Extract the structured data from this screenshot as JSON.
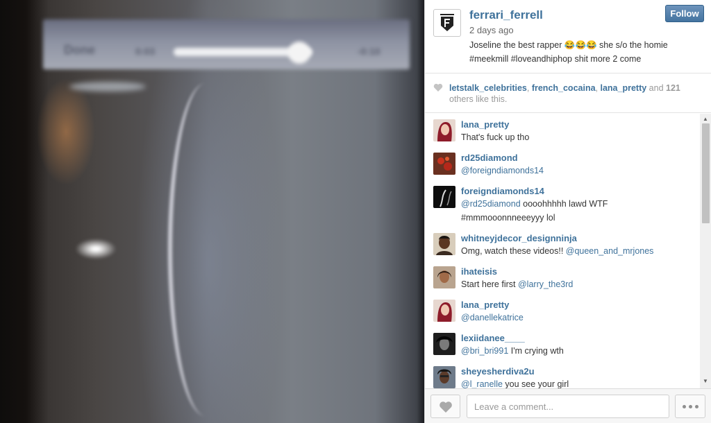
{
  "photo": {
    "bar_left": "Done",
    "bar_time_left": "0:03",
    "bar_time_right": "-0:10"
  },
  "post": {
    "username": "ferrari_ferrell",
    "time_ago": "2 days ago",
    "caption": "Joseline the best rapper 😂😂😂 she s/o the homie #meekmill #loveandhiphop shit more 2 come",
    "follow_label": "Follow"
  },
  "likes": {
    "users": [
      "letstalk_celebrities",
      "french_cocaina",
      "lana_pretty"
    ],
    "sep1": ", ",
    "sep2": ", ",
    "and": " and ",
    "count": "121",
    "suffix": " others like this."
  },
  "comments": [
    {
      "user": "lana_pretty",
      "parts": [
        {
          "t": "That's fuck up tho",
          "m": false
        }
      ],
      "avatar": "lana"
    },
    {
      "user": "rd25diamond",
      "parts": [
        {
          "t": "@foreigndiamonds14",
          "m": true
        }
      ],
      "avatar": "rd25"
    },
    {
      "user": "foreigndiamonds14",
      "parts": [
        {
          "t": "@rd25diamond",
          "m": true
        },
        {
          "t": " oooohhhhh lawd WTF #mmmooonnneeeyyy lol",
          "m": false
        }
      ],
      "avatar": "foreign"
    },
    {
      "user": "whitneyjdecor_designninja",
      "parts": [
        {
          "t": "Omg, watch these videos!! ",
          "m": false
        },
        {
          "t": "@queen_and_mrjones",
          "m": true
        }
      ],
      "avatar": "whitney"
    },
    {
      "user": "ihateisis",
      "parts": [
        {
          "t": "Start here first ",
          "m": false
        },
        {
          "t": "@larry_the3rd",
          "m": true
        }
      ],
      "avatar": "isis"
    },
    {
      "user": "lana_pretty",
      "parts": [
        {
          "t": "@danellekatrice",
          "m": true
        }
      ],
      "avatar": "lana"
    },
    {
      "user": "lexiidanee____",
      "parts": [
        {
          "t": "@bri_bri991",
          "m": true
        },
        {
          "t": " I'm crying wth",
          "m": false
        }
      ],
      "avatar": "lexii"
    },
    {
      "user": "sheyesherdiva2u",
      "parts": [
        {
          "t": "@l_ranelle",
          "m": true
        },
        {
          "t": " you see your girl",
          "m": false
        }
      ],
      "avatar": "sheyes"
    }
  ],
  "footer": {
    "comment_placeholder": "Leave a comment..."
  },
  "colors": {
    "link": "#3f729b",
    "follow_button": "#4474a0"
  },
  "icons": [
    "brand-logo-icon",
    "heart-icon",
    "more-dots-icon",
    "scroll-up-arrow-icon",
    "scroll-down-arrow-icon"
  ]
}
